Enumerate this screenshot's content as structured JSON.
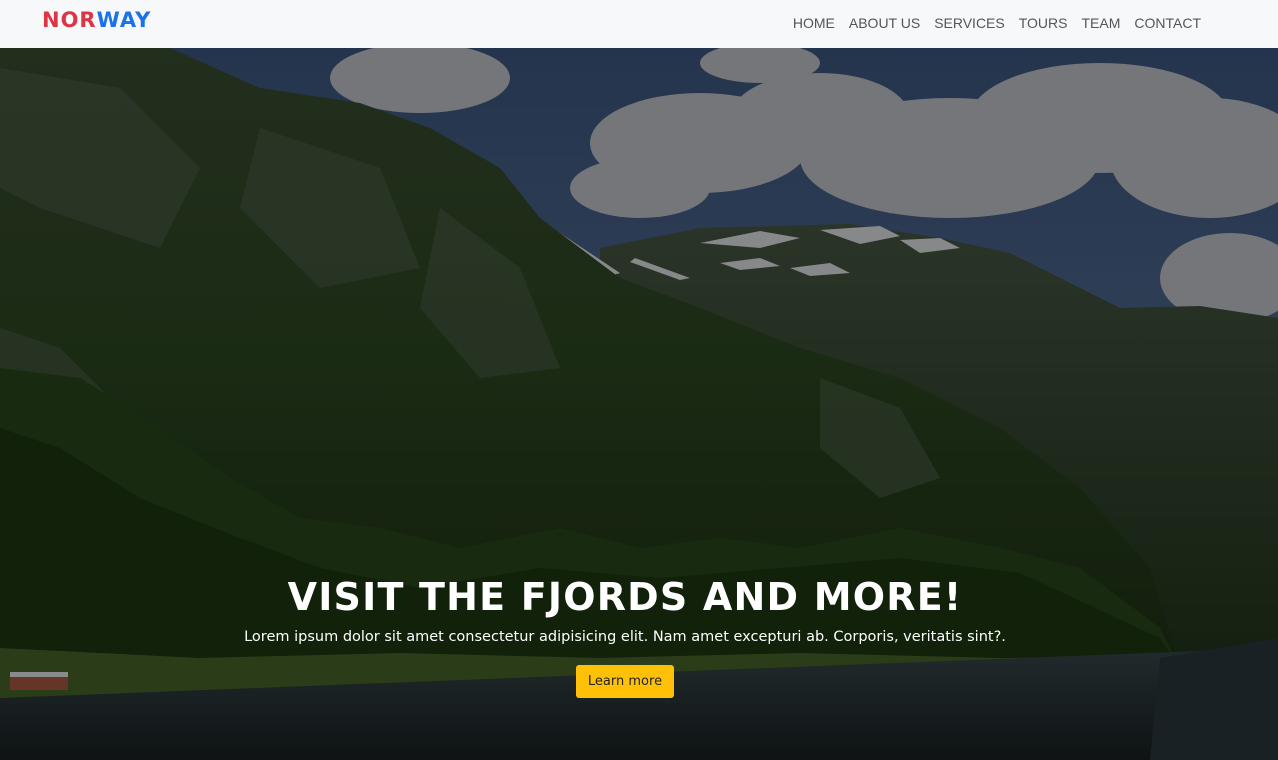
{
  "brand": {
    "part1": "NOR",
    "part2": "WAY"
  },
  "nav": {
    "items": [
      {
        "label": "HOME"
      },
      {
        "label": "ABOUT US"
      },
      {
        "label": "SERVICES"
      },
      {
        "label": "TOURS"
      },
      {
        "label": "TEAM"
      },
      {
        "label": "CONTACT"
      }
    ]
  },
  "hero": {
    "image": "fjord-mountain-landscape",
    "title": "VISIT THE FJORDS AND MORE!",
    "subtitle": "Lorem ipsum dolor sit amet consectetur adipisicing elit. Nam amet excepturi ab. Corporis, veritatis sint?.",
    "cta_label": "Learn more"
  },
  "colors": {
    "brand_red": "#dc3545",
    "brand_blue": "#1a73e8",
    "cta_yellow": "#ffc107",
    "nav_bg": "#f7f8fa"
  }
}
